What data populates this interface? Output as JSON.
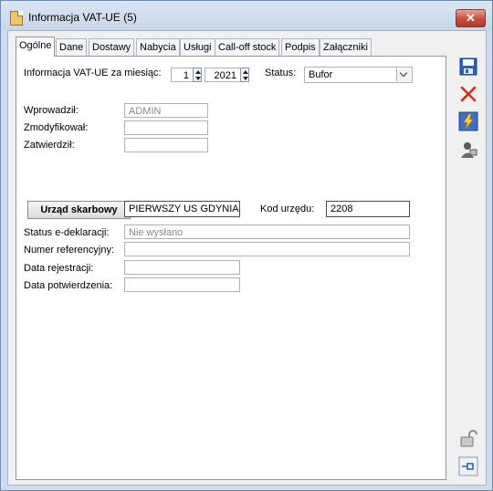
{
  "window": {
    "title": "Informacja VAT-UE (5)",
    "close_glyph": "✕"
  },
  "tabs": [
    "Ogólne",
    "Dane",
    "Dostawy",
    "Nabycia",
    "Usługi",
    "Call-off stock",
    "Podpis",
    "Załączniki"
  ],
  "form": {
    "period_label": "Informacja VAT-UE za miesiąc:",
    "month": "1",
    "year": "2021",
    "status_label": "Status:",
    "status_value": "Bufor",
    "wprowadzil_label": "Wprowadził:",
    "wprowadzil_value": "ADMIN",
    "zmodyfikowal_label": "Zmodyfikował:",
    "zmodyfikowal_value": "",
    "zatwierdzil_label": "Zatwierdził:",
    "zatwierdzil_value": "",
    "urzad_button": "Urząd skarbowy",
    "urzad_value": "PIERWSZY US GDYNIA",
    "kod_urzedu_label": "Kod urzędu:",
    "kod_urzedu_value": "2208",
    "status_edeklaracji_label": "Status e-deklaracji:",
    "status_edeklaracji_value": "Nie wysłano",
    "numer_ref_label": "Numer referencyjny:",
    "numer_ref_value": "",
    "data_rejestracji_label": "Data rejestracji:",
    "data_rejestracji_value": "",
    "data_potwierdzenia_label": "Data potwierdzenia:",
    "data_potwierdzenia_value": ""
  },
  "toolbar": [
    "save-icon",
    "delete-icon",
    "generate-lightning-icon",
    "user-operator-icon",
    "lock-icon",
    "pin-icon"
  ],
  "colors": {
    "accent": "#2f62b1",
    "delete": "#d62c1f",
    "close": "#c74e39"
  }
}
